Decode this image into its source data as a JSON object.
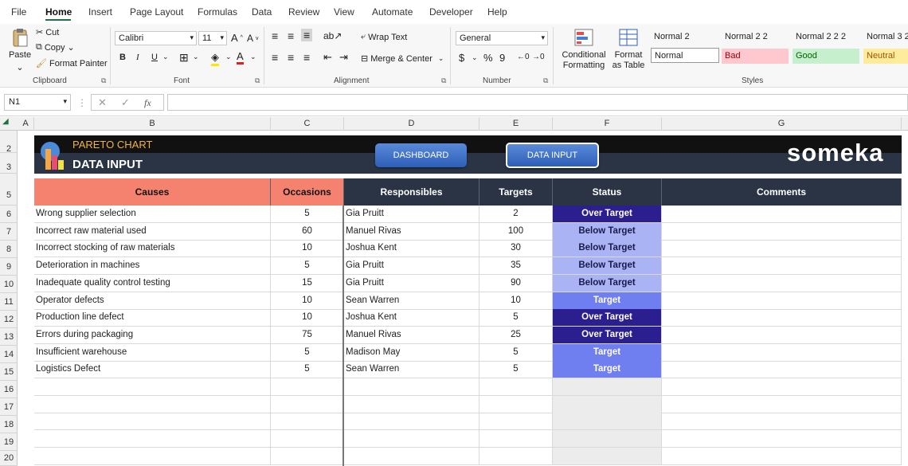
{
  "menu": [
    "File",
    "Home",
    "Insert",
    "Page Layout",
    "Formulas",
    "Data",
    "Review",
    "View",
    "Automate",
    "Developer",
    "Help"
  ],
  "ribbon": {
    "clipboard": {
      "paste": "Paste",
      "cut": "Cut",
      "copy": "Copy",
      "format_painter": "Format Painter",
      "label": "Clipboard"
    },
    "font": {
      "name": "Calibri",
      "size": "11",
      "bold": "B",
      "italic": "I",
      "underline": "U",
      "label": "Font"
    },
    "alignment": {
      "wrap": "Wrap Text",
      "merge": "Merge & Center",
      "label": "Alignment"
    },
    "number": {
      "format": "General",
      "currency": "$",
      "percent": "%",
      "comma": "9",
      "label": "Number"
    },
    "styles": {
      "conditional": "Conditional Formatting",
      "table": "Format as Table",
      "cells": [
        {
          "label": "Normal 2",
          "bg": "#f7f7f7"
        },
        {
          "label": "Normal 2 2",
          "bg": "#f7f7f7"
        },
        {
          "label": "Normal 2 2 2",
          "bg": "#f7f7f7"
        },
        {
          "label": "Normal 3 2",
          "bg": "#f7f7f7"
        },
        {
          "label": "Normal",
          "bg": "#ffffff"
        },
        {
          "label": "Bad",
          "bg": "#ffc7ce"
        },
        {
          "label": "Good",
          "bg": "#c6efce"
        },
        {
          "label": "Neutral",
          "bg": "#ffeb9c"
        }
      ],
      "label": "Styles"
    }
  },
  "formula_bar": {
    "name_box": "N1",
    "fx": "fx",
    "value": ""
  },
  "columns": [
    "A",
    "B",
    "C",
    "D",
    "E",
    "F",
    "G"
  ],
  "rows": [
    "2",
    "3",
    "5",
    "6",
    "7",
    "8",
    "9",
    "10",
    "11",
    "12",
    "13",
    "14",
    "15",
    "16",
    "17",
    "18",
    "19",
    "20"
  ],
  "banner": {
    "title_top": "PARETO CHART",
    "title_main": "DATA INPUT",
    "btn_dashboard": "DASHBOARD",
    "btn_data_input": "DATA INPUT",
    "brand": "someka"
  },
  "table": {
    "headers": {
      "causes": "Causes",
      "occasions": "Occasions",
      "responsibles": "Responsibles",
      "targets": "Targets",
      "status": "Status",
      "comments": "Comments"
    },
    "rows": [
      {
        "cause": "Wrong supplier selection",
        "occ": "5",
        "resp": "Gia Pruitt",
        "target": "2",
        "status": "Over Target"
      },
      {
        "cause": "Incorrect raw material used",
        "occ": "60",
        "resp": "Manuel Rivas",
        "target": "100",
        "status": "Below Target"
      },
      {
        "cause": "Incorrect stocking of raw materials",
        "occ": "10",
        "resp": "Joshua Kent",
        "target": "30",
        "status": "Below Target"
      },
      {
        "cause": "Deterioration in machines",
        "occ": "5",
        "resp": "Gia Pruitt",
        "target": "35",
        "status": "Below Target"
      },
      {
        "cause": "Inadequate quality control testing",
        "occ": "15",
        "resp": "Gia Pruitt",
        "target": "90",
        "status": "Below Target"
      },
      {
        "cause": "Operator defects",
        "occ": "10",
        "resp": "Sean Warren",
        "target": "10",
        "status": "Target"
      },
      {
        "cause": "Production line defect",
        "occ": "10",
        "resp": "Joshua Kent",
        "target": "5",
        "status": "Over Target"
      },
      {
        "cause": "Errors during packaging",
        "occ": "75",
        "resp": "Manuel Rivas",
        "target": "25",
        "status": "Over Target"
      },
      {
        "cause": "Insufficient warehouse",
        "occ": "5",
        "resp": "Madison May",
        "target": "5",
        "status": "Target"
      },
      {
        "cause": "Logistics Defect",
        "occ": "5",
        "resp": "Sean Warren",
        "target": "5",
        "status": "Target"
      }
    ]
  },
  "colors": {
    "causes_header": "#f4826e",
    "dark_header": "#2a3445",
    "over": "#2b1f8f",
    "below": "#aab4f5",
    "target": "#6f7ff0",
    "accent": "#1e7145"
  }
}
